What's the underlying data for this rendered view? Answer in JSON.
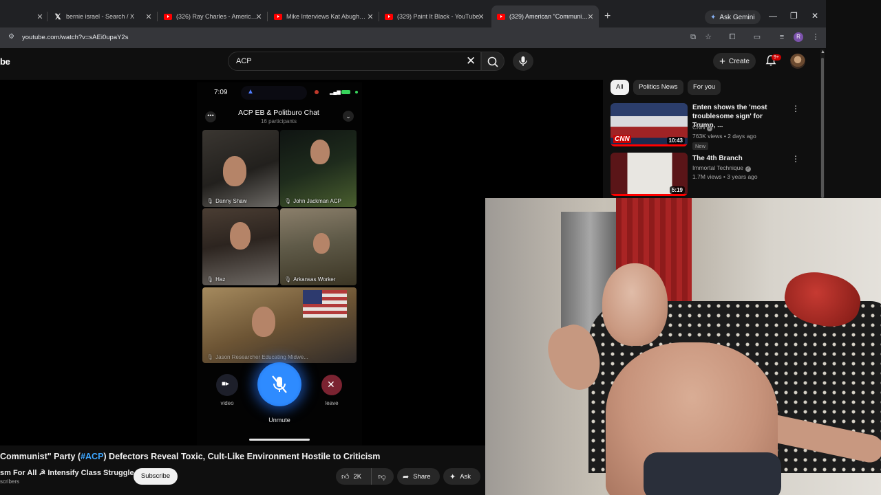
{
  "browser": {
    "tabs": [
      {
        "title": "",
        "icon": "blank"
      },
      {
        "title": "bernie israel - Search / X",
        "icon": "x-logo"
      },
      {
        "title": "(326) Ray Charles - America The",
        "icon": "youtube"
      },
      {
        "title": "Mike Interviews Kat Abughazale",
        "icon": "youtube"
      },
      {
        "title": "(329) Paint It Black - YouTube",
        "icon": "youtube"
      },
      {
        "title": "(329) American \"Communist\" P",
        "icon": "youtube",
        "active": true
      }
    ],
    "new_tab": "+",
    "ask_gemini": "Ask Gemini",
    "url": "youtube.com/watch?v=sAEi0upaY2s",
    "profile_initial": "R"
  },
  "youtube": {
    "logo_fragment": "be",
    "search_query": "ACP",
    "create_label": "Create",
    "notifications_badge": "9+",
    "chips": [
      "All",
      "Politics News",
      "For you"
    ],
    "related": [
      {
        "title": "Enten shows the 'most troublesome sign' for Trump, ...",
        "channel": "CNN",
        "meta": "763K views • 2 days ago",
        "badge": "New",
        "duration": "10:43",
        "thumb_logo": "CNN"
      },
      {
        "title": "The 4th Branch",
        "channel": "Immortal Technique",
        "meta": "1.7M views • 3 years ago",
        "duration": "5:19"
      }
    ]
  },
  "video": {
    "phone_time": "7:09",
    "chat_title": "ACP EB & Politburo Chat",
    "chat_subtitle": "16 participants",
    "participants": [
      "Danny Shaw",
      "John Jackman ACP",
      "Haz",
      "Arkansas Worker",
      "Jason Researcher Educating Midwe..."
    ],
    "controls": {
      "video": "video",
      "unmute": "Unmute",
      "leave": "leave"
    }
  },
  "watch": {
    "title_prefix": "Communist\" Party (",
    "title_tag": "#ACP",
    "title_suffix": ") Defectors Reveal Toxic, Cult-Like Environment Hostile to Criticism",
    "channel": "sm For All ☭ Intensify Class Struggle",
    "subscribers": "scribers",
    "subscribe": "Subscribe",
    "likes": "2K",
    "share": "Share",
    "ask": "Ask"
  }
}
